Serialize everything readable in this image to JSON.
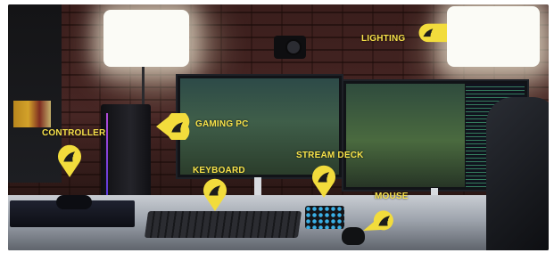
{
  "scene": {
    "labels": {
      "lighting": "LIGHTING",
      "gaming_pc": "GAMING PC",
      "controller": "CONTROLLER",
      "keyboard": "KEYBOARD",
      "stream_deck": "STREAM DECK",
      "mouse": "MOUSE"
    },
    "icon": "corsair-sails-icon"
  },
  "colors": {
    "accent": "#f7e24a",
    "pin_fill": "#f2dc3c",
    "pin_dark": "#1c1c1c"
  }
}
